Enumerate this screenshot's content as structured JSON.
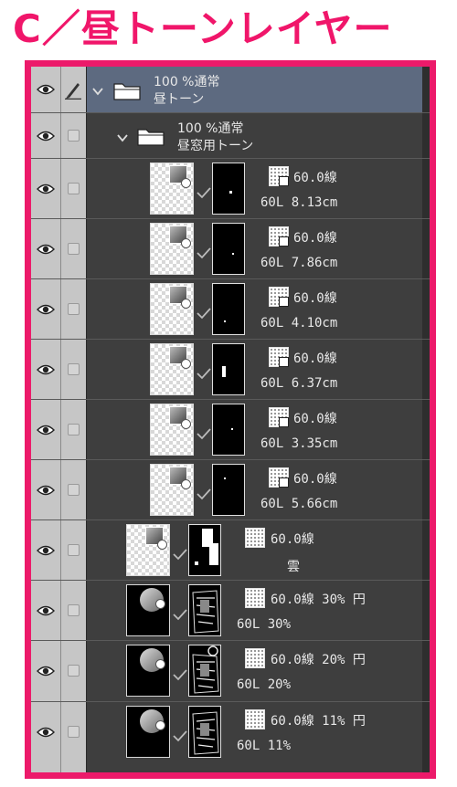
{
  "title": "C／昼トーンレイヤー",
  "colors": {
    "accent": "#ec1a6a",
    "selected_row": "#5d6a80",
    "panel": "#3e3e3e",
    "sidebar": "#c6c6c6"
  },
  "folders": [
    {
      "opacity_mode": "100 %通常",
      "name": "昼トーン",
      "selected": true
    },
    {
      "opacity_mode": "100 %通常",
      "name": "昼窓用トーン",
      "selected": false
    }
  ],
  "layers": [
    {
      "tone": "60.0線",
      "name": "60L 8.13cm"
    },
    {
      "tone": "60.0線",
      "name": "60L 7.86cm"
    },
    {
      "tone": "60.0線",
      "name": "60L 4.10cm"
    },
    {
      "tone": "60.0線",
      "name": "60L 6.37cm"
    },
    {
      "tone": "60.0線",
      "name": "60L 3.35cm"
    },
    {
      "tone": "60.0線",
      "name": "60L 5.66cm"
    },
    {
      "tone": "60.0線",
      "name": "雲"
    },
    {
      "tone": "60.0線 30% 円",
      "name": "60L 30%"
    },
    {
      "tone": "60.0線 20% 円",
      "name": "60L 20%"
    },
    {
      "tone": "60.0線 11% 円",
      "name": "60L 11%"
    }
  ]
}
